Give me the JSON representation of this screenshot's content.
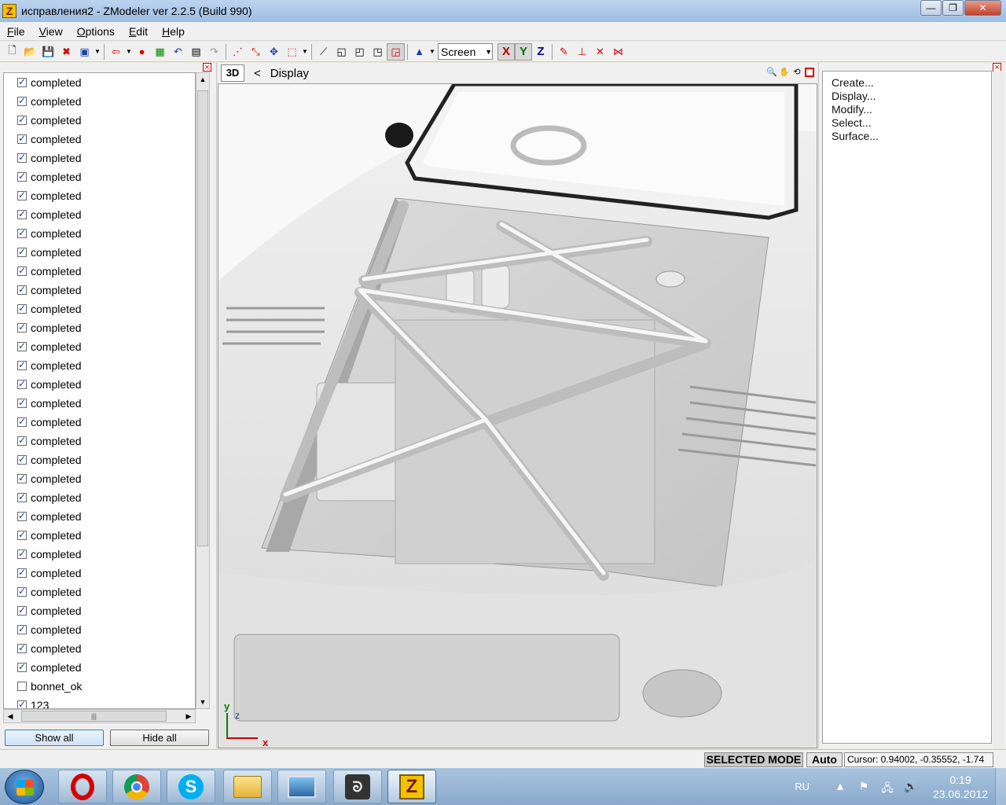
{
  "window": {
    "title": "исправления2 - ZModeler ver 2.2.5 (Build 990)",
    "app_icon_letter": "Z",
    "minimize": "—",
    "maximize": "❐",
    "close": "✕"
  },
  "menu": [
    {
      "label": "File",
      "key": "F"
    },
    {
      "label": "View",
      "key": "V"
    },
    {
      "label": "Options",
      "key": "O"
    },
    {
      "label": "Edit",
      "key": "E"
    },
    {
      "label": "Help",
      "key": "H"
    }
  ],
  "toolbar": {
    "view_select": "Screen",
    "axis_x": "X",
    "axis_y": "Y",
    "axis_z": "Z"
  },
  "left_panel": {
    "items": [
      {
        "label": "completed",
        "checked": true
      },
      {
        "label": "completed",
        "checked": true
      },
      {
        "label": "completed",
        "checked": true
      },
      {
        "label": "completed",
        "checked": true
      },
      {
        "label": "completed",
        "checked": true
      },
      {
        "label": "completed",
        "checked": true
      },
      {
        "label": "completed",
        "checked": true
      },
      {
        "label": "completed",
        "checked": true
      },
      {
        "label": "completed",
        "checked": true
      },
      {
        "label": "completed",
        "checked": true
      },
      {
        "label": "completed",
        "checked": true
      },
      {
        "label": "completed",
        "checked": true
      },
      {
        "label": "completed",
        "checked": true
      },
      {
        "label": "completed",
        "checked": true
      },
      {
        "label": "completed",
        "checked": true
      },
      {
        "label": "completed",
        "checked": true
      },
      {
        "label": "completed",
        "checked": true
      },
      {
        "label": "completed",
        "checked": true
      },
      {
        "label": "completed",
        "checked": true
      },
      {
        "label": "completed",
        "checked": true
      },
      {
        "label": "completed",
        "checked": true
      },
      {
        "label": "completed",
        "checked": true
      },
      {
        "label": "completed",
        "checked": true
      },
      {
        "label": "completed",
        "checked": true
      },
      {
        "label": "completed",
        "checked": true
      },
      {
        "label": "completed",
        "checked": true
      },
      {
        "label": "completed",
        "checked": true
      },
      {
        "label": "completed",
        "checked": true
      },
      {
        "label": "completed",
        "checked": true
      },
      {
        "label": "completed",
        "checked": true
      },
      {
        "label": "completed",
        "checked": true
      },
      {
        "label": "completed",
        "checked": true
      },
      {
        "label": "bonnet_ok",
        "checked": false
      },
      {
        "label": "123",
        "checked": true
      }
    ],
    "show_all": "Show all",
    "hide_all": "Hide all"
  },
  "viewport": {
    "mode_label": "3D",
    "nav_arrow": "<",
    "title": "Display",
    "axis_labels": {
      "y": "y",
      "z": "z",
      "x": "x"
    }
  },
  "right_panel": {
    "items": [
      "Create...",
      "Display...",
      "Modify...",
      "Select...",
      "Surface..."
    ]
  },
  "status": {
    "mode": "SELECTED MODE",
    "auto": "Auto",
    "cursor": "Cursor: 0.94002, -0.35552, -1.74"
  },
  "taskbar": {
    "lang": "RU",
    "time": "0:19",
    "date": "23.06.2012",
    "apps": [
      "opera-icon",
      "chrome-icon",
      "skype-icon",
      "explorer-icon",
      "image-viewer-icon",
      "3dsmax-icon",
      "zmodeler-icon"
    ]
  },
  "colors": {
    "accent_red": "#d00000",
    "axis_green": "#007000",
    "axis_blue": "#000090"
  }
}
